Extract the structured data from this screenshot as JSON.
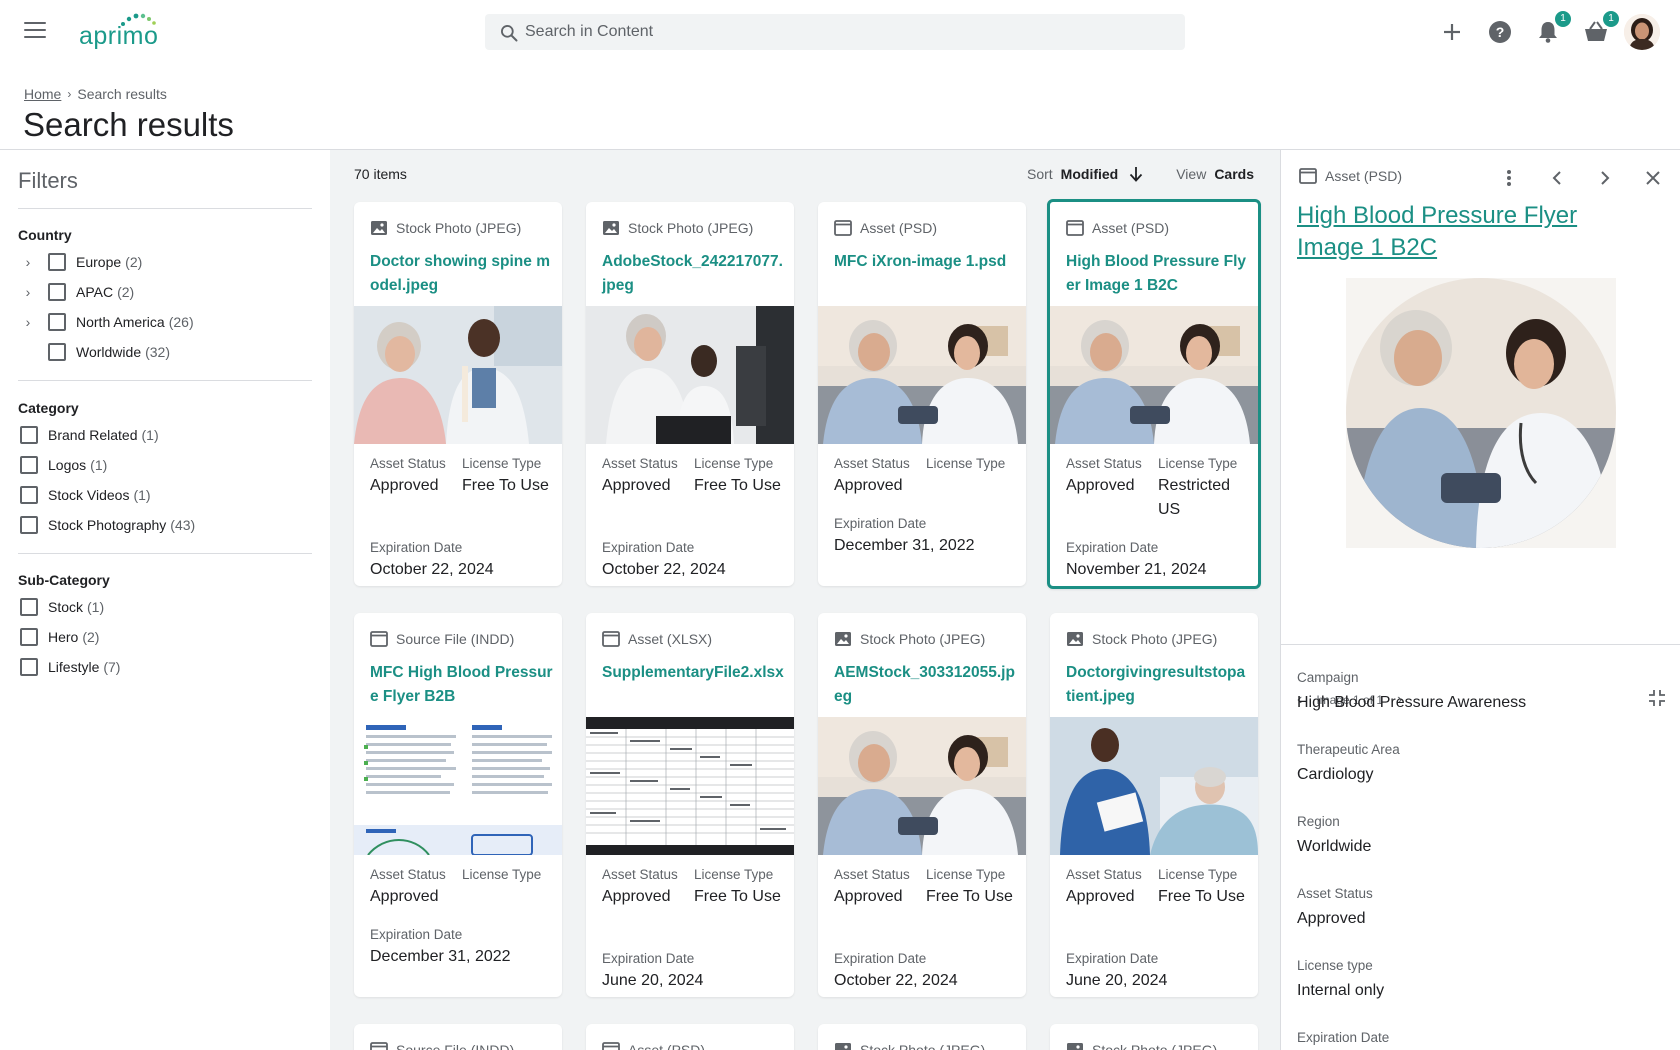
{
  "app": {
    "logo_text": "aprimo",
    "brand_color": "#1b9a8a"
  },
  "search": {
    "placeholder": "Search in Content"
  },
  "topbar": {
    "notifications_badge": "1",
    "cart_badge": "1"
  },
  "breadcrumb": {
    "home": "Home",
    "current": "Search results"
  },
  "page_title": "Search results",
  "filters": {
    "title": "Filters",
    "groups": [
      {
        "title": "Country",
        "options": [
          {
            "label": "Europe",
            "count": "(2)",
            "expandable": true
          },
          {
            "label": "APAC",
            "count": "(2)",
            "expandable": true
          },
          {
            "label": "North America",
            "count": "(26)",
            "expandable": true
          },
          {
            "label": "Worldwide",
            "count": "(32)",
            "expandable": false
          }
        ]
      },
      {
        "title": "Category",
        "options": [
          {
            "label": "Brand Related",
            "count": "(1)"
          },
          {
            "label": "Logos",
            "count": "(1)"
          },
          {
            "label": "Stock Videos",
            "count": "(1)"
          },
          {
            "label": "Stock Photography",
            "count": "(43)"
          }
        ]
      },
      {
        "title": "Sub-Category",
        "options": [
          {
            "label": "Stock",
            "count": "(1)"
          },
          {
            "label": "Hero",
            "count": "(2)"
          },
          {
            "label": "Lifestyle",
            "count": "(7)"
          }
        ]
      }
    ]
  },
  "results": {
    "count": "70 items",
    "sort_label": "Sort",
    "sort_value": "Modified",
    "view_label": "View",
    "view_value": "Cards",
    "labels": {
      "status": "Asset Status",
      "license": "License Type",
      "expiration": "Expiration Date"
    },
    "cards": [
      {
        "type": "Stock Photo (JPEG)",
        "title": "Doctor showing spine model.jpeg",
        "status": "Approved",
        "license": "Free To Use",
        "expiration": "October 22, 2024",
        "icon": "image-icon",
        "thumb": "spine"
      },
      {
        "type": "Stock Photo (JPEG)",
        "title": "AdobeStock_242217077.jpeg",
        "status": "Approved",
        "license": "Free To Use",
        "expiration": "October 22, 2024",
        "icon": "image-icon",
        "thumb": "lab"
      },
      {
        "type": "Asset (PSD)",
        "title": "MFC iXron-image 1.psd",
        "status": "Approved",
        "license": "",
        "expiration": "December 31, 2022",
        "icon": "window-icon",
        "thumb": "nurse"
      },
      {
        "type": "Asset (PSD)",
        "title": "High Blood Pressure Flyer Image 1 B2C",
        "status": "Approved",
        "license": "Restricted US",
        "expiration": "November 21, 2024",
        "icon": "window-icon",
        "thumb": "nurse",
        "selected": true
      },
      {
        "type": "Source File (INDD)",
        "title": "MFC High Blood Pressure Flyer B2B",
        "status": "Approved",
        "license": "",
        "expiration": "December 31, 2022",
        "icon": "window-icon",
        "thumb": "flyer"
      },
      {
        "type": "Asset (XLSX)",
        "title": "SupplementaryFile2.xlsx",
        "status": "Approved",
        "license": "Free To Use",
        "expiration": "June 20, 2024",
        "icon": "window-icon",
        "thumb": "sheet"
      },
      {
        "type": "Stock Photo (JPEG)",
        "title": "AEMStock_303312055.jpeg",
        "status": "Approved",
        "license": "Free To Use",
        "expiration": "October 22, 2024",
        "icon": "image-icon",
        "thumb": "nurse"
      },
      {
        "type": "Stock Photo (JPEG)",
        "title": "Doctorgivingresultstopatient.jpeg",
        "status": "Approved",
        "license": "Free To Use",
        "expiration": "June 20, 2024",
        "icon": "image-icon",
        "thumb": "bed"
      }
    ],
    "partial_row_types": [
      "Source File (INDD)",
      "Asset (PSD)",
      "Stock Photo (JPEG)",
      "Stock Photo (JPEG)"
    ]
  },
  "detail": {
    "type": "Asset (PSD)",
    "title": "High Blood Pressure Flyer Image 1 B2C",
    "image_nav": "Image 1 of 1",
    "fields": [
      {
        "label": "Campaign",
        "value": "High Blood Pressure Awareness"
      },
      {
        "label": "Therapeutic Area",
        "value": "Cardiology"
      },
      {
        "label": "Region",
        "value": "Worldwide"
      },
      {
        "label": "Asset Status",
        "value": "Approved"
      },
      {
        "label": "License type",
        "value": "Internal only"
      },
      {
        "label": "Expiration Date",
        "value": ""
      }
    ]
  }
}
